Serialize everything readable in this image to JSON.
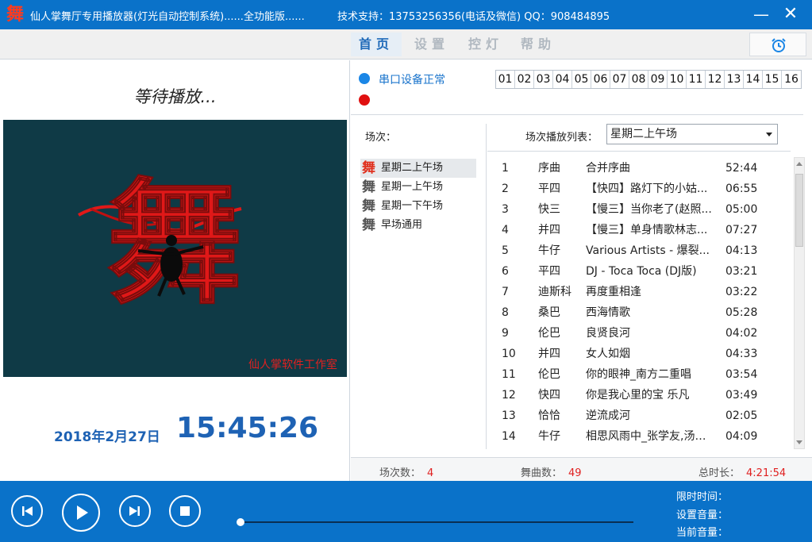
{
  "titlebar": {
    "app_title": "仙人掌舞厅专用播放器(灯光自动控制系统)......全功能版......",
    "support": "技术支持：13753256356(电话及微信)  QQ：908484895",
    "logo_char": "舞",
    "minimize_glyph": "—",
    "close_glyph": "✕"
  },
  "tabs": [
    {
      "label": "首页",
      "active": true
    },
    {
      "label": "设置",
      "active": false
    },
    {
      "label": "控灯",
      "active": false
    },
    {
      "label": "帮助",
      "active": false
    }
  ],
  "left": {
    "status": "等待播放...",
    "studio": "仙人掌软件工作室",
    "video_char": "舞",
    "date": "2018年2月27日",
    "time": "15:45:26"
  },
  "device": {
    "serial_status": "串口设备正常",
    "channels": [
      "01",
      "02",
      "03",
      "04",
      "05",
      "06",
      "07",
      "08",
      "09",
      "10",
      "11",
      "12",
      "13",
      "14",
      "15",
      "16"
    ]
  },
  "sessions": {
    "label": "场次：",
    "mark": "舞",
    "items": [
      "星期二上午场",
      "星期一上午场",
      "星期一下午场",
      "早场通用"
    ],
    "selected": 0
  },
  "playlist": {
    "label": "场次播放列表：",
    "selected": "星期二上午场",
    "songs": [
      {
        "no": "1",
        "style": "序曲",
        "name": "合并序曲",
        "dur": "52:44"
      },
      {
        "no": "2",
        "style": "平四",
        "name": "【快四】路灯下的小姑...",
        "dur": "06:55"
      },
      {
        "no": "3",
        "style": "快三",
        "name": "【慢三】当你老了(赵照...",
        "dur": "05:00"
      },
      {
        "no": "4",
        "style": "并四",
        "name": "【慢三】单身情歌林志...",
        "dur": "07:27"
      },
      {
        "no": "5",
        "style": "牛仔",
        "name": "Various Artists - 爆裂...",
        "dur": "04:13"
      },
      {
        "no": "6",
        "style": "平四",
        "name": "DJ - Toca Toca (DJ版)",
        "dur": "03:21"
      },
      {
        "no": "7",
        "style": "迪斯科",
        "name": "再度重相逢",
        "dur": "03:22"
      },
      {
        "no": "8",
        "style": "桑巴",
        "name": "西海情歌",
        "dur": "05:28"
      },
      {
        "no": "9",
        "style": "伦巴",
        "name": "良贤良河",
        "dur": "04:02"
      },
      {
        "no": "10",
        "style": "并四",
        "name": "女人如烟",
        "dur": "04:33"
      },
      {
        "no": "11",
        "style": "伦巴",
        "name": "你的眼神_南方二重唱",
        "dur": "03:54"
      },
      {
        "no": "12",
        "style": "快四",
        "name": "你是我心里的宝 乐凡",
        "dur": "03:49"
      },
      {
        "no": "13",
        "style": "恰恰",
        "name": "逆流成河",
        "dur": "02:05"
      },
      {
        "no": "14",
        "style": "牛仔",
        "name": "相思风雨中_张学友,汤宝...",
        "dur": "04:09"
      }
    ]
  },
  "stats": {
    "sessions_label": "场次数：",
    "sessions_value": "4",
    "songs_label": "舞曲数：",
    "songs_value": "49",
    "total_label": "总时长：",
    "total_value": "4:21:54"
  },
  "player": {
    "progress": 0.0,
    "limit_time_label": "限时时间：",
    "set_volume_label": "设置音量：",
    "current_volume_label": "当前音量："
  },
  "colors": {
    "brand_blue": "#0a72c9",
    "accent_red": "#e02020",
    "text_blue": "#1e62b4"
  }
}
